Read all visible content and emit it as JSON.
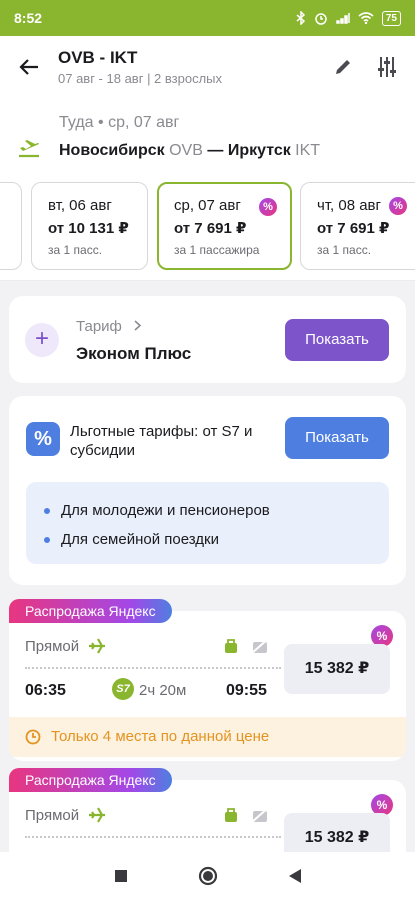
{
  "status": {
    "time": "8:52",
    "battery": "75"
  },
  "header": {
    "title": "OVB - IKT",
    "subtitle": "07 авг - 18 авг | 2 взрослых"
  },
  "route": {
    "direction": "Туда • ср, 07 авг",
    "from_city": "Новосибирск",
    "from_code": "OVB",
    "separator": "—",
    "to_city": "Иркутск",
    "to_code": "IKT"
  },
  "dates": [
    {
      "day": "вт, 06 авг",
      "price": "от 10 131 ₽",
      "note": "за 1 пасс.",
      "discount": false
    },
    {
      "day": "ср, 07 авг",
      "price": "от 7 691 ₽",
      "note": "за 1 пассажира",
      "discount": true
    },
    {
      "day": "чт, 08 авг",
      "price": "от 7 691 ₽",
      "note": "за 1 пасс.",
      "discount": true
    }
  ],
  "tariff": {
    "label": "Тариф",
    "name": "Эконом Плюс",
    "button": "Показать"
  },
  "benefits": {
    "title": "Льготные тарифы: от S7 и субсидии",
    "button": "Показать",
    "items": [
      "Для молодежи и пенсионеров",
      "Для семейной поездки"
    ]
  },
  "flights": [
    {
      "sale_tag": "Распродажа Яндекс",
      "type": "Прямой",
      "depart": "06:35",
      "airline_badge": "S7",
      "duration": "2ч 20м",
      "arrive": "09:55",
      "price": "15 382 ₽",
      "warning": "Только 4 места по данной цене"
    },
    {
      "sale_tag": "Распродажа Яндекс",
      "type": "Прямой",
      "price": "15 382 ₽"
    }
  ],
  "colors": {
    "accent_green": "#8ab52e",
    "purple": "#7e54cb",
    "blue": "#4e7fe0",
    "warning": "#e39420"
  }
}
